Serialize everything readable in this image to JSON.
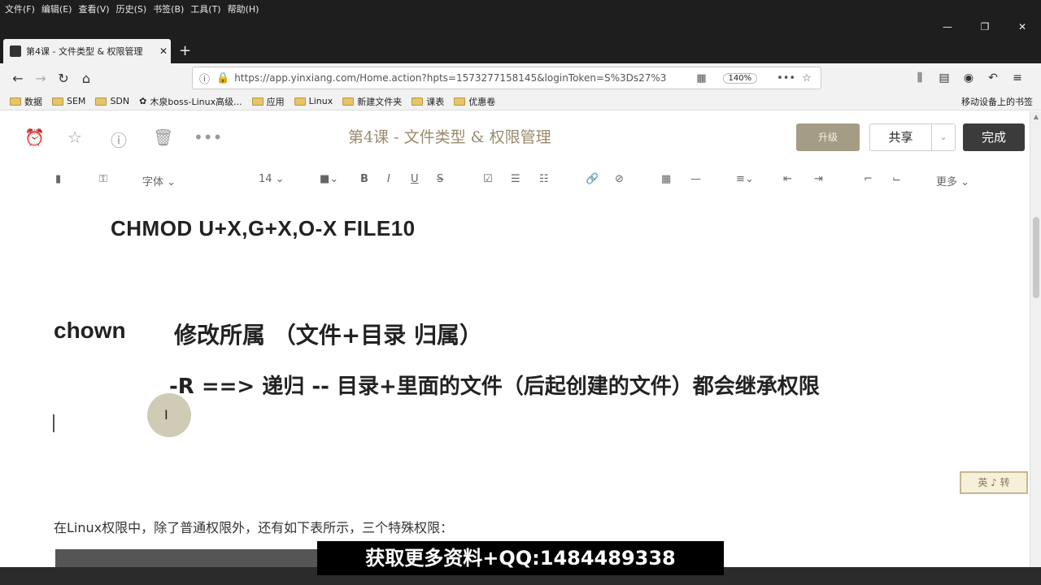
{
  "menubar": [
    "文件(F)",
    "编辑(E)",
    "查看(V)",
    "历史(S)",
    "书签(B)",
    "工具(T)",
    "帮助(H)"
  ],
  "window_controls": [
    "—",
    "❐",
    "✕"
  ],
  "tab": {
    "title": "第4课 - 文件类型 & 权限管理",
    "close": "✕",
    "new": "+"
  },
  "toolbar": {
    "url": "https://app.yinxiang.com/Home.action?hpts=1573277158145&loginToken=S%3Ds27%3",
    "zoom": "140%",
    "more": "•••",
    "star": "☆"
  },
  "bookmarks": [
    "数据",
    "SEM",
    "SDN",
    "木泉boss-Linux高级...",
    "应用",
    "Linux",
    "新建文件夹",
    "课表",
    "优惠卷"
  ],
  "mobile_bookmarks": "移动设备上的书签",
  "editor": {
    "title": "第4课 - 文件类型 & 权限管理",
    "upgrade": "升级",
    "share": "共享",
    "done": "完成",
    "font": "字体",
    "size": "14",
    "more": "更多"
  },
  "document": {
    "line1": "CHMOD  U+X,G+X,O-X  FILE10",
    "line2_cmd": "chown",
    "line2_desc": "修改所属 （文件+目录  归属）",
    "line3": "-R  ==> 递归 -- 目录+里面的文件（后起创建的文件）都会继承权限",
    "paragraph": "在Linux权限中，除了普通权限外，还有如下表所示，三个特殊权限：",
    "stamp": "英 ♪ 转"
  },
  "overlay": {
    "promo": "获取更多资料+QQ:1484489338"
  }
}
